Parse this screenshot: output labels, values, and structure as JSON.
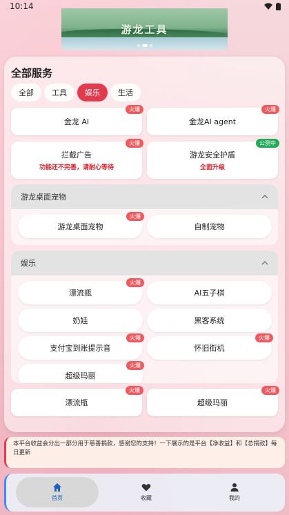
{
  "status": {
    "time": "10:14"
  },
  "banner": {
    "title": "游龙工具",
    "active_dot": 1
  },
  "services": {
    "title": "全部服务",
    "tabs": [
      {
        "label": "全部",
        "active": false
      },
      {
        "label": "工具",
        "active": false
      },
      {
        "label": "娱乐",
        "active": true
      },
      {
        "label": "生活",
        "active": false
      }
    ],
    "cards": [
      {
        "label": "金龙 AI",
        "badge": "火爆"
      },
      {
        "label": "金龙AI agent",
        "badge": "火爆"
      },
      {
        "label": "拦截广告",
        "sub": "功能还不完善，请耐心等待",
        "badge": "火爆"
      },
      {
        "label": "游龙安全护盾",
        "sub": "全面升级",
        "badge": "公测中"
      }
    ]
  },
  "group_pet": {
    "title": "游龙桌面宠物",
    "items": [
      {
        "label": "游龙桌面宠物",
        "badge": "火爆"
      },
      {
        "label": "自制宠物"
      }
    ]
  },
  "group_ent": {
    "title": "娱乐",
    "items": [
      {
        "label": "漂流瓶",
        "badge": "火爆"
      },
      {
        "label": "AI五子棋"
      },
      {
        "label": "奶娃"
      },
      {
        "label": "黑客系统"
      },
      {
        "label": "支付宝到账提示音",
        "badge": "火爆"
      },
      {
        "label": "怀旧街机",
        "badge": "火爆"
      },
      {
        "label": "超级玛丽",
        "badge": "火爆"
      }
    ]
  },
  "extra_cards": [
    {
      "label": "漂流瓶",
      "badge": "火爆"
    },
    {
      "label": "超级玛丽",
      "badge": "火爆"
    }
  ],
  "notice": {
    "text": "本平台收益会分出一部分用于慈善捐款，感谢您的支持！一下展示的是平台【净收益】和【总捐款】每日更新"
  },
  "nav": {
    "items": [
      {
        "label": "首页",
        "icon": "home-icon",
        "active": true
      },
      {
        "label": "收藏",
        "icon": "heart-icon",
        "active": false
      },
      {
        "label": "我的",
        "icon": "user-icon",
        "active": false
      }
    ]
  },
  "colors": {
    "accent": "#e23b4e",
    "badge": "#ef5a5f",
    "badge_green": "#22a95a",
    "nav_active": "#1f5fbf"
  }
}
